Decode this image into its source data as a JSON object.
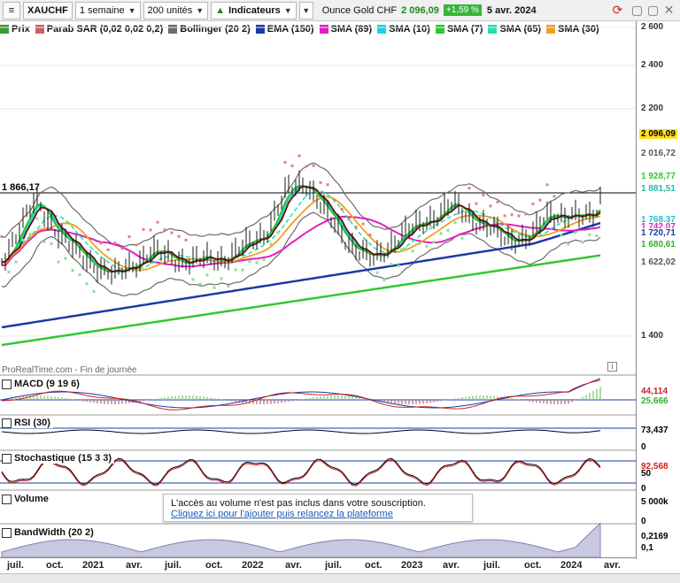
{
  "toolbar": {
    "symbol": "XAUCHF",
    "period": "1 semaine",
    "units": "200 unités",
    "indicators": "Indicateurs",
    "instrument_name": "Ounce Gold CHF",
    "last_price": "2 096,09",
    "change": "+1,59 %",
    "date": "5 avr. 2024"
  },
  "legend": [
    {
      "label": "Prix",
      "color": "#3a9a3a"
    },
    {
      "label": "Parab SAR (0,02 0,02 0,2)",
      "color": "#d06060"
    },
    {
      "label": "Bollinger (20 2)",
      "color": "#6b6b6b"
    },
    {
      "label": "EMA (150)",
      "color": "#1a3aa8"
    },
    {
      "label": "SMA (89)",
      "color": "#e020c0"
    },
    {
      "label": "SMA (10)",
      "color": "#20d0e0"
    },
    {
      "label": "SMA (7)",
      "color": "#30c830"
    },
    {
      "label": "SMA (65)",
      "color": "#20e0b0"
    },
    {
      "label": "SMA (30)",
      "color": "#f0a020"
    }
  ],
  "price_axis": {
    "ticks": [
      {
        "label": "2 600",
        "value": 2600
      },
      {
        "label": "2 400",
        "value": 2400
      },
      {
        "label": "2 200",
        "value": 2200
      },
      {
        "label": "1 400",
        "value": 1400
      }
    ],
    "price_labels": [
      {
        "text": "2 096,09",
        "value": 2096.09,
        "bg": "#ffe020",
        "fg": "#000"
      },
      {
        "text": "2 016,72",
        "value": 2016.72,
        "bg": "#ffffff",
        "fg": "#555"
      },
      {
        "text": "1 928,77",
        "value": 1928.77,
        "bg": "#ffffff",
        "fg": "#30c830"
      },
      {
        "text": "1 881,51",
        "value": 1881.51,
        "bg": "#ffffff",
        "fg": "#20c0a0"
      },
      {
        "text": "1 768,37",
        "value": 1768.37,
        "bg": "#ffffff",
        "fg": "#20c0d0"
      },
      {
        "text": "1 742,07",
        "value": 1742.07,
        "bg": "#ffffff",
        "fg": "#e020c0"
      },
      {
        "text": "1 720,71",
        "value": 1720.71,
        "bg": "#ffffff",
        "fg": "#1a3aa8"
      },
      {
        "text": "1 680,61",
        "value": 1680.61,
        "bg": "#ffffff",
        "fg": "#30b030"
      },
      {
        "text": "1 622,02",
        "value": 1622.02,
        "bg": "#ffffff",
        "fg": "#555"
      }
    ],
    "hline_label": "1 866,17",
    "hline_value": 1866.17
  },
  "watermark": "ProRealTime.com - Fin de journée",
  "panels": {
    "macd": {
      "title": "MACD (9 19 6)",
      "values": [
        "44,114",
        "25,666"
      ]
    },
    "rsi": {
      "title": "RSI (30)",
      "value": "73,437",
      "zero": "0"
    },
    "stoch": {
      "title": "Stochastique (15 3 3)",
      "value": "92,568",
      "mid": "50",
      "zero": "0"
    },
    "volume": {
      "title": "Volume",
      "scale": "5 000k",
      "zero": "0"
    },
    "bandwidth": {
      "title": "BandWidth (20 2)",
      "value": "0,2169",
      "tick": "0,1"
    }
  },
  "notice": {
    "line1": "L'accès au volume n'est pas inclus dans votre souscription.",
    "line2": "Cliquez ici pour l'ajouter puis relancez la plateforme"
  },
  "x_axis": [
    "juil.",
    "oct.",
    "2021",
    "avr.",
    "juil.",
    "oct.",
    "2022",
    "avr.",
    "juil.",
    "oct.",
    "2023",
    "avr.",
    "juil.",
    "oct.",
    "2024",
    "avr."
  ]
}
